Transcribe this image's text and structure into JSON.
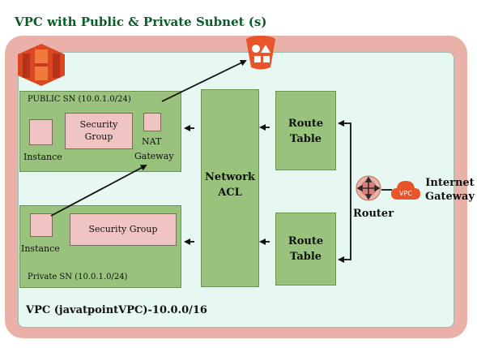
{
  "title": "VPC with Public & Private Subnet (s)",
  "public_subnet": {
    "label": "PUBLIC SN (10.0.1.0/24)",
    "instance_label": "Instance",
    "security_group_line1": "Security",
    "security_group_line2": "Group",
    "nat_line1": "NAT",
    "nat_line2": "Gateway"
  },
  "private_subnet": {
    "label": "Private SN (10.0.1.0/24)",
    "instance_label": "Instance",
    "security_group": "Security Group"
  },
  "network_acl": {
    "line1": "Network",
    "line2": "ACL"
  },
  "route_tables": [
    {
      "line1": "Route",
      "line2": "Table"
    },
    {
      "line1": "Route",
      "line2": "Table"
    }
  ],
  "router_label": "Router",
  "vpc_badge": "VPC",
  "internet_gateway": {
    "line1": "Internet",
    "line2": "Gateway"
  },
  "vpc_label": "VPC (javatpointVPC)-10.0.0/16",
  "colors": {
    "outer": "#e9b1a8",
    "inner": "#e6f8f1",
    "green_box": "#99c27d",
    "pink_box": "#efc4c2",
    "title": "#0b5c2a",
    "accent_orange": "#e8542b"
  }
}
